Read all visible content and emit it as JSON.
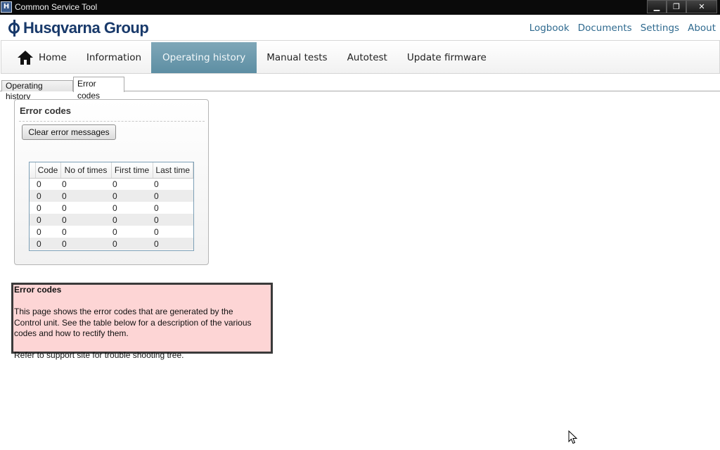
{
  "window": {
    "title": "Common Service Tool",
    "app_icon": "husqvarna-app-icon",
    "controls": {
      "minimize": "▁",
      "restore": "❐",
      "close": "✕"
    }
  },
  "header": {
    "logo_text": "Husqvarna Group",
    "links": [
      "Logbook",
      "Documents",
      "Settings",
      "About"
    ]
  },
  "nav": {
    "home_icon": "home-icon",
    "items": [
      "Home",
      "Information",
      "Operating history",
      "Manual tests",
      "Autotest",
      "Update firmware"
    ],
    "active": "Operating history"
  },
  "subtabs": {
    "items": [
      "Operating history",
      "Error codes"
    ],
    "active": "Error codes"
  },
  "error_panel": {
    "title": "Error codes",
    "clear_button": "Clear error messages",
    "columns": [
      "Code",
      "No of times",
      "First time",
      "Last time"
    ],
    "rows": [
      [
        "0",
        "0",
        "0",
        "0"
      ],
      [
        "0",
        "0",
        "0",
        "0"
      ],
      [
        "0",
        "0",
        "0",
        "0"
      ],
      [
        "0",
        "0",
        "0",
        "0"
      ],
      [
        "0",
        "0",
        "0",
        "0"
      ],
      [
        "0",
        "0",
        "0",
        "0"
      ]
    ]
  },
  "info": {
    "title": "Error codes",
    "text": "This page shows the error codes that are generated by the Control unit. See the table below for a description of the various codes and how to rectify them.",
    "reference": "Refer to support site for trouble shooting tree."
  },
  "colors": {
    "brand": "#18396a",
    "link": "#2f6a8f",
    "active_nav": "#6c99ad",
    "info_bg": "#fdd5d5"
  }
}
